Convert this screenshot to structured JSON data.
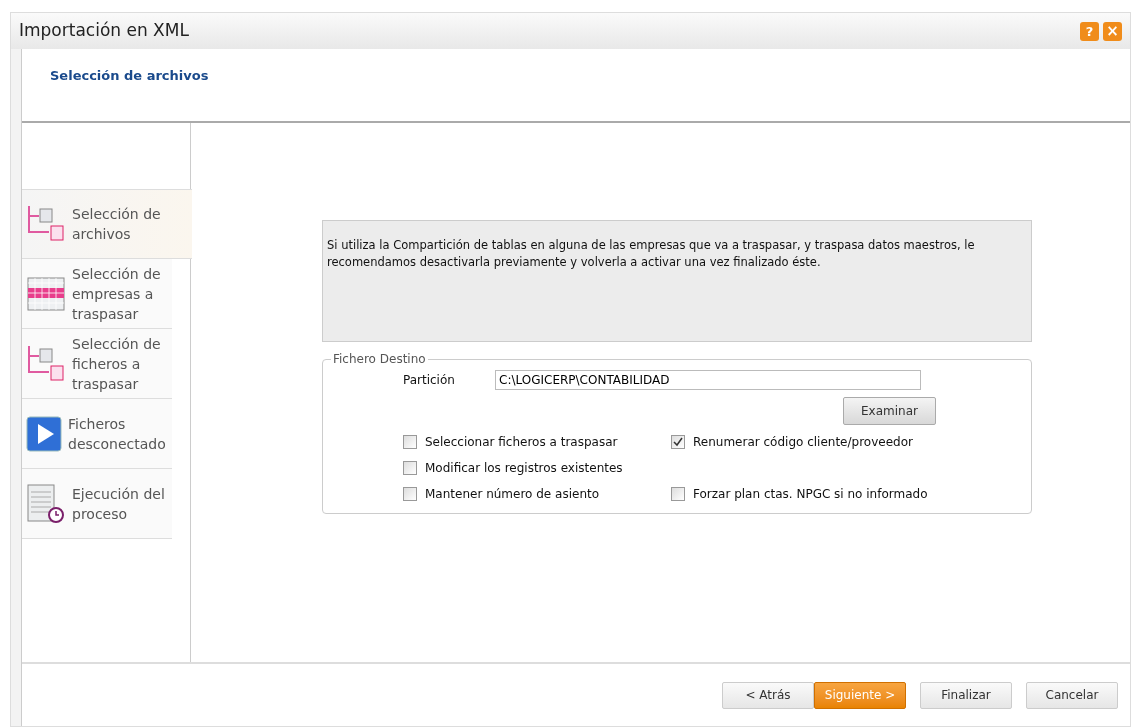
{
  "window": {
    "title": "Importación en XML",
    "help": "?",
    "close": "×"
  },
  "header": {
    "title": "Selección de archivos"
  },
  "sidebar": {
    "items": [
      {
        "label": "Selección de archivos",
        "kind": "tree",
        "selected": true
      },
      {
        "label": "Selección de empresas a traspasar",
        "kind": "grid",
        "selected": false
      },
      {
        "label": "Selección de ficheros a traspasar",
        "kind": "tree",
        "selected": false
      },
      {
        "label": "Ficheros desconectado",
        "kind": "play",
        "selected": false
      },
      {
        "label": "Ejecución del proceso",
        "kind": "clock",
        "selected": false
      }
    ]
  },
  "notice": "Si utiliza la Compartición de tablas en alguna de las empresas que va a traspasar, y traspasa datos maestros, le recomendamos desactivarla previamente y volverla a activar una vez finalizado éste.",
  "group": {
    "title": "Fichero Destino",
    "field_label": "Partición",
    "field_value": "C:\\LOGICERP\\CONTABILIDAD",
    "browse": "Examinar",
    "checkbox_rows": [
      [
        {
          "label": "Seleccionar ficheros a traspasar",
          "checked": false
        },
        {
          "label": "Renumerar código cliente/proveedor",
          "checked": true
        }
      ],
      [
        {
          "label": "Modificar los registros existentes",
          "checked": false
        }
      ],
      [
        {
          "label": "Mantener número de asiento",
          "checked": false
        },
        {
          "label": "Forzar plan ctas. NPGC si no informado",
          "checked": false
        }
      ]
    ]
  },
  "buttons": [
    {
      "label": "< Atrás",
      "primary": false
    },
    {
      "label": "Siguiente >",
      "primary": true
    },
    {
      "label": "Finalizar",
      "primary": false
    },
    {
      "label": "Cancelar",
      "primary": false
    }
  ]
}
